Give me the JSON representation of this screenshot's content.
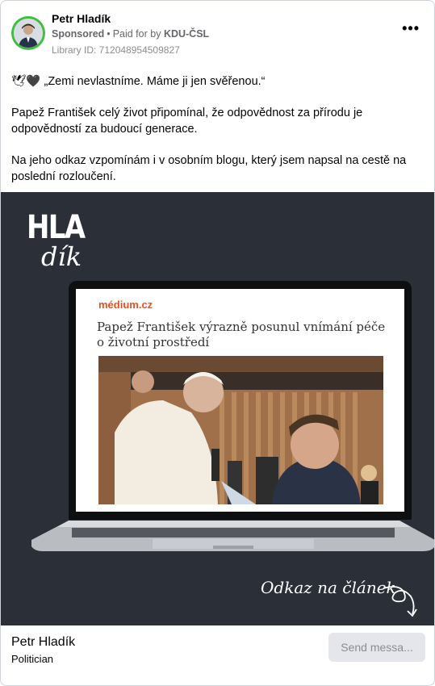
{
  "header": {
    "author": "Petr Hladík",
    "sponsored_label": "Sponsored",
    "paid_for_by_label": "Paid for by",
    "paid_for_by_org": "KDU-ČSL",
    "library_id": "Library ID: 712048954509827",
    "more_icon": "more-dots-icon"
  },
  "post": {
    "emoji": "🕊🖤",
    "line1": "„Zemi nevlastníme. Máme ji jen svěřenou.“",
    "line2": "Papež František celý život připomínal, že odpovědnost za přírodu je odpovědností za budoucí generace.",
    "line3": "Na jeho odkaz vzpomínám i v osobním blogu, který jsem napsal na cestě na poslední rozloučení."
  },
  "media": {
    "logo_top": "HLA",
    "logo_bottom": "dík",
    "site_name": "médium.cz",
    "headline": "Papež František výrazně posunul vnímání péče o životní prostředí",
    "caption": "Odkaz na článek",
    "background_color": "#2b3038"
  },
  "footer": {
    "name": "Petr Hladík",
    "role": "Politician",
    "send_button": "Send messa..."
  }
}
